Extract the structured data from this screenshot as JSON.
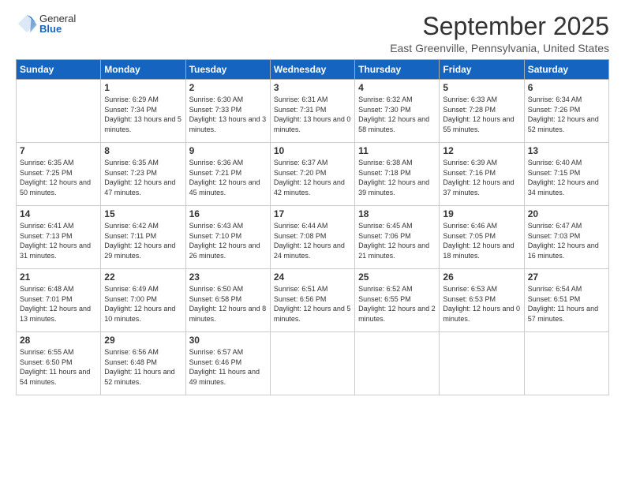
{
  "logo": {
    "general": "General",
    "blue": "Blue"
  },
  "title": "September 2025",
  "location": "East Greenville, Pennsylvania, United States",
  "headers": [
    "Sunday",
    "Monday",
    "Tuesday",
    "Wednesday",
    "Thursday",
    "Friday",
    "Saturday"
  ],
  "weeks": [
    [
      {
        "day": "",
        "sunrise": "",
        "sunset": "",
        "daylight": ""
      },
      {
        "day": "1",
        "sunrise": "Sunrise: 6:29 AM",
        "sunset": "Sunset: 7:34 PM",
        "daylight": "Daylight: 13 hours and 5 minutes."
      },
      {
        "day": "2",
        "sunrise": "Sunrise: 6:30 AM",
        "sunset": "Sunset: 7:33 PM",
        "daylight": "Daylight: 13 hours and 3 minutes."
      },
      {
        "day": "3",
        "sunrise": "Sunrise: 6:31 AM",
        "sunset": "Sunset: 7:31 PM",
        "daylight": "Daylight: 13 hours and 0 minutes."
      },
      {
        "day": "4",
        "sunrise": "Sunrise: 6:32 AM",
        "sunset": "Sunset: 7:30 PM",
        "daylight": "Daylight: 12 hours and 58 minutes."
      },
      {
        "day": "5",
        "sunrise": "Sunrise: 6:33 AM",
        "sunset": "Sunset: 7:28 PM",
        "daylight": "Daylight: 12 hours and 55 minutes."
      },
      {
        "day": "6",
        "sunrise": "Sunrise: 6:34 AM",
        "sunset": "Sunset: 7:26 PM",
        "daylight": "Daylight: 12 hours and 52 minutes."
      }
    ],
    [
      {
        "day": "7",
        "sunrise": "Sunrise: 6:35 AM",
        "sunset": "Sunset: 7:25 PM",
        "daylight": "Daylight: 12 hours and 50 minutes."
      },
      {
        "day": "8",
        "sunrise": "Sunrise: 6:35 AM",
        "sunset": "Sunset: 7:23 PM",
        "daylight": "Daylight: 12 hours and 47 minutes."
      },
      {
        "day": "9",
        "sunrise": "Sunrise: 6:36 AM",
        "sunset": "Sunset: 7:21 PM",
        "daylight": "Daylight: 12 hours and 45 minutes."
      },
      {
        "day": "10",
        "sunrise": "Sunrise: 6:37 AM",
        "sunset": "Sunset: 7:20 PM",
        "daylight": "Daylight: 12 hours and 42 minutes."
      },
      {
        "day": "11",
        "sunrise": "Sunrise: 6:38 AM",
        "sunset": "Sunset: 7:18 PM",
        "daylight": "Daylight: 12 hours and 39 minutes."
      },
      {
        "day": "12",
        "sunrise": "Sunrise: 6:39 AM",
        "sunset": "Sunset: 7:16 PM",
        "daylight": "Daylight: 12 hours and 37 minutes."
      },
      {
        "day": "13",
        "sunrise": "Sunrise: 6:40 AM",
        "sunset": "Sunset: 7:15 PM",
        "daylight": "Daylight: 12 hours and 34 minutes."
      }
    ],
    [
      {
        "day": "14",
        "sunrise": "Sunrise: 6:41 AM",
        "sunset": "Sunset: 7:13 PM",
        "daylight": "Daylight: 12 hours and 31 minutes."
      },
      {
        "day": "15",
        "sunrise": "Sunrise: 6:42 AM",
        "sunset": "Sunset: 7:11 PM",
        "daylight": "Daylight: 12 hours and 29 minutes."
      },
      {
        "day": "16",
        "sunrise": "Sunrise: 6:43 AM",
        "sunset": "Sunset: 7:10 PM",
        "daylight": "Daylight: 12 hours and 26 minutes."
      },
      {
        "day": "17",
        "sunrise": "Sunrise: 6:44 AM",
        "sunset": "Sunset: 7:08 PM",
        "daylight": "Daylight: 12 hours and 24 minutes."
      },
      {
        "day": "18",
        "sunrise": "Sunrise: 6:45 AM",
        "sunset": "Sunset: 7:06 PM",
        "daylight": "Daylight: 12 hours and 21 minutes."
      },
      {
        "day": "19",
        "sunrise": "Sunrise: 6:46 AM",
        "sunset": "Sunset: 7:05 PM",
        "daylight": "Daylight: 12 hours and 18 minutes."
      },
      {
        "day": "20",
        "sunrise": "Sunrise: 6:47 AM",
        "sunset": "Sunset: 7:03 PM",
        "daylight": "Daylight: 12 hours and 16 minutes."
      }
    ],
    [
      {
        "day": "21",
        "sunrise": "Sunrise: 6:48 AM",
        "sunset": "Sunset: 7:01 PM",
        "daylight": "Daylight: 12 hours and 13 minutes."
      },
      {
        "day": "22",
        "sunrise": "Sunrise: 6:49 AM",
        "sunset": "Sunset: 7:00 PM",
        "daylight": "Daylight: 12 hours and 10 minutes."
      },
      {
        "day": "23",
        "sunrise": "Sunrise: 6:50 AM",
        "sunset": "Sunset: 6:58 PM",
        "daylight": "Daylight: 12 hours and 8 minutes."
      },
      {
        "day": "24",
        "sunrise": "Sunrise: 6:51 AM",
        "sunset": "Sunset: 6:56 PM",
        "daylight": "Daylight: 12 hours and 5 minutes."
      },
      {
        "day": "25",
        "sunrise": "Sunrise: 6:52 AM",
        "sunset": "Sunset: 6:55 PM",
        "daylight": "Daylight: 12 hours and 2 minutes."
      },
      {
        "day": "26",
        "sunrise": "Sunrise: 6:53 AM",
        "sunset": "Sunset: 6:53 PM",
        "daylight": "Daylight: 12 hours and 0 minutes."
      },
      {
        "day": "27",
        "sunrise": "Sunrise: 6:54 AM",
        "sunset": "Sunset: 6:51 PM",
        "daylight": "Daylight: 11 hours and 57 minutes."
      }
    ],
    [
      {
        "day": "28",
        "sunrise": "Sunrise: 6:55 AM",
        "sunset": "Sunset: 6:50 PM",
        "daylight": "Daylight: 11 hours and 54 minutes."
      },
      {
        "day": "29",
        "sunrise": "Sunrise: 6:56 AM",
        "sunset": "Sunset: 6:48 PM",
        "daylight": "Daylight: 11 hours and 52 minutes."
      },
      {
        "day": "30",
        "sunrise": "Sunrise: 6:57 AM",
        "sunset": "Sunset: 6:46 PM",
        "daylight": "Daylight: 11 hours and 49 minutes."
      },
      {
        "day": "",
        "sunrise": "",
        "sunset": "",
        "daylight": ""
      },
      {
        "day": "",
        "sunrise": "",
        "sunset": "",
        "daylight": ""
      },
      {
        "day": "",
        "sunrise": "",
        "sunset": "",
        "daylight": ""
      },
      {
        "day": "",
        "sunrise": "",
        "sunset": "",
        "daylight": ""
      }
    ]
  ]
}
